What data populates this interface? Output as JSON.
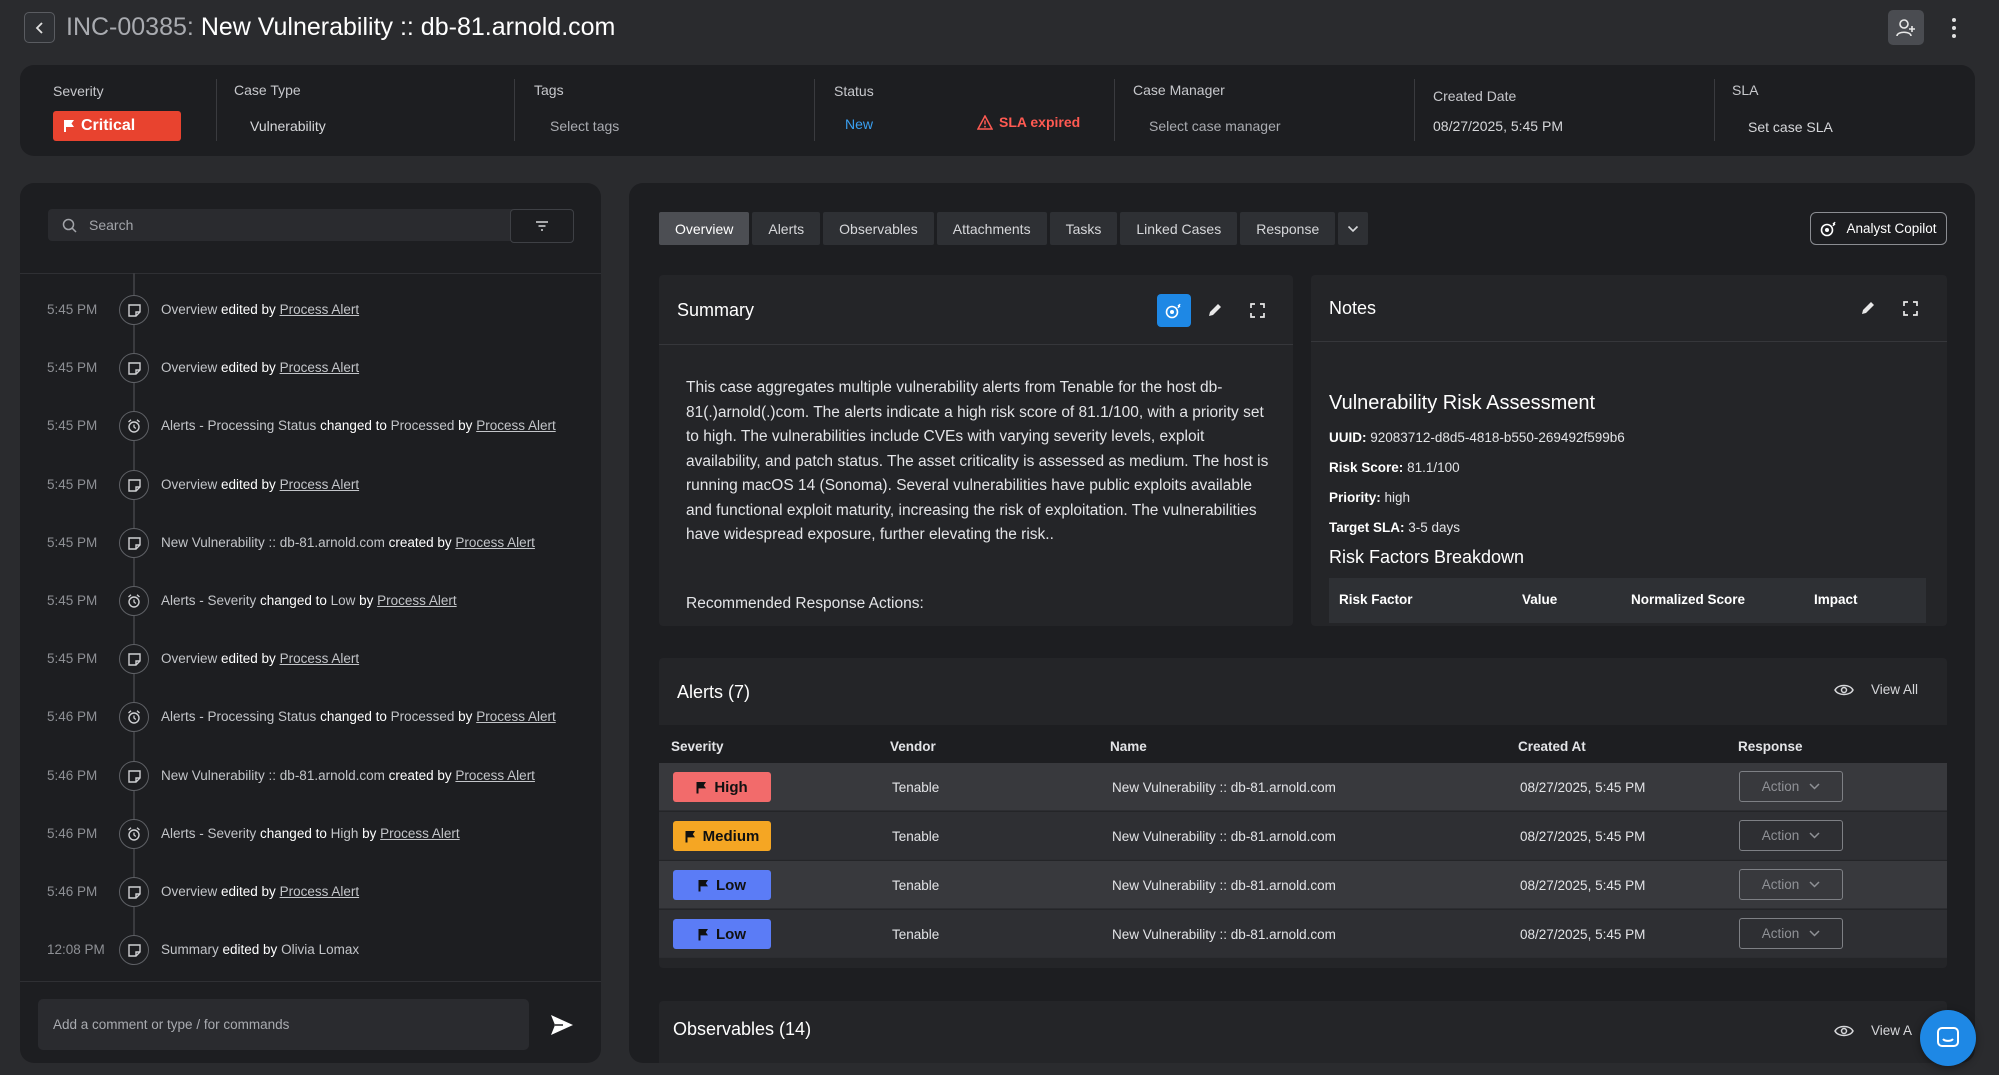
{
  "header": {
    "incident_id": "INC-00385:",
    "title": "New Vulnerability :: db-81.arnold.com"
  },
  "info": {
    "severity": {
      "label": "Severity",
      "value": "Critical",
      "color": "#e8432f"
    },
    "case_type": {
      "label": "Case Type",
      "value": "Vulnerability"
    },
    "tags": {
      "label": "Tags",
      "placeholder": "Select tags"
    },
    "status": {
      "label": "Status",
      "value": "New",
      "sla": "SLA expired"
    },
    "case_manager": {
      "label": "Case Manager",
      "placeholder": "Select case manager"
    },
    "created_date": {
      "label": "Created Date",
      "value": "08/27/2025, 5:45 PM"
    },
    "sla": {
      "label": "SLA",
      "placeholder": "Set case SLA"
    }
  },
  "left": {
    "search_placeholder": "Search",
    "comment_placeholder": "Add a comment or type / for commands",
    "timeline": [
      {
        "time": "5:45 PM",
        "icon": "note-icon",
        "a": "Overview",
        "verb": " edited by ",
        "b": "",
        "c": "",
        "actor": "Process Alert",
        "actor_link": true
      },
      {
        "time": "5:45 PM",
        "icon": "note-icon",
        "a": "Overview",
        "verb": " edited by ",
        "b": "",
        "c": "",
        "actor": "Process Alert",
        "actor_link": true
      },
      {
        "time": "5:45 PM",
        "icon": "alarm-icon",
        "a": "Alerts - Processing Status",
        "verb": " changed to ",
        "b": "Processed",
        "c": " by ",
        "actor": "Process Alert",
        "actor_link": true
      },
      {
        "time": "5:45 PM",
        "icon": "note-icon",
        "a": "Overview",
        "verb": " edited by ",
        "b": "",
        "c": "",
        "actor": "Process Alert",
        "actor_link": true
      },
      {
        "time": "5:45 PM",
        "icon": "note-icon",
        "a": "New Vulnerability :: db-81.arnold.com",
        "verb": " created by ",
        "b": "",
        "c": "",
        "actor": "Process Alert",
        "actor_link": true
      },
      {
        "time": "5:45 PM",
        "icon": "alarm-icon",
        "a": "Alerts - Severity",
        "verb": " changed to ",
        "b": "Low",
        "c": " by ",
        "actor": "Process Alert",
        "actor_link": true
      },
      {
        "time": "5:45 PM",
        "icon": "note-icon",
        "a": "Overview",
        "verb": " edited by ",
        "b": "",
        "c": "",
        "actor": "Process Alert",
        "actor_link": true
      },
      {
        "time": "5:46 PM",
        "icon": "alarm-icon",
        "a": "Alerts - Processing Status",
        "verb": " changed to ",
        "b": "Processed",
        "c": " by ",
        "actor": "Process Alert",
        "actor_link": true
      },
      {
        "time": "5:46 PM",
        "icon": "note-icon",
        "a": "New Vulnerability :: db-81.arnold.com",
        "verb": " created by ",
        "b": "",
        "c": "",
        "actor": "Process Alert",
        "actor_link": true
      },
      {
        "time": "5:46 PM",
        "icon": "alarm-icon",
        "a": "Alerts - Severity",
        "verb": " changed to ",
        "b": "High",
        "c": " by ",
        "actor": "Process Alert",
        "actor_link": true
      },
      {
        "time": "5:46 PM",
        "icon": "note-icon",
        "a": "Overview",
        "verb": " edited by ",
        "b": "",
        "c": "",
        "actor": "Process Alert",
        "actor_link": true
      },
      {
        "time": "12:08 PM",
        "icon": "note-icon",
        "a": "Summary",
        "verb": " edited by ",
        "b": "",
        "c": "",
        "actor": "Olivia Lomax",
        "actor_link": false
      }
    ]
  },
  "tabs": [
    "Overview",
    "Alerts",
    "Observables",
    "Attachments",
    "Tasks",
    "Linked Cases",
    "Response"
  ],
  "copilot_label": "Analyst Copilot",
  "summary": {
    "title": "Summary",
    "body": "This case aggregates multiple vulnerability alerts from Tenable for the host db-81(.)arnold(.)com. The alerts indicate a high risk score of 81.1/100, with a priority set to high. The vulnerabilities include CVEs with varying severity levels, exploit availability, and patch status. The asset criticality is assessed as medium. The host is running macOS 14 (Sonoma). Several vulnerabilities have public exploits available and functional exploit maturity, increasing the risk of exploitation. The vulnerabilities have widespread exposure, further elevating the risk..",
    "rec": "Recommended Response Actions:"
  },
  "notes": {
    "title": "Notes",
    "heading": "Vulnerability Risk Assessment",
    "uuid_label": "UUID:",
    "uuid": "92083712-d8d5-4818-b550-269492f599b6",
    "risk_label": "Risk Score:",
    "risk": "81.1/100",
    "priority_label": "Priority:",
    "priority": "high",
    "sla_label": "Target SLA:",
    "sla": "3-5 days",
    "breakdown": "Risk Factors Breakdown",
    "columns": [
      "Risk Factor",
      "Value",
      "Normalized Score",
      "Impact"
    ]
  },
  "alerts": {
    "title": "Alerts (7)",
    "view_all": "View All",
    "columns": [
      "Severity",
      "Vendor",
      "Name",
      "Created At",
      "Response"
    ],
    "rows": [
      {
        "severity": "High",
        "color": "#f26b6b",
        "vendor": "Tenable",
        "name": "New Vulnerability :: db-81.arnold.com",
        "created": "08/27/2025, 5:45 PM",
        "action": "Action"
      },
      {
        "severity": "Medium",
        "color": "#f5a623",
        "vendor": "Tenable",
        "name": "New Vulnerability :: db-81.arnold.com",
        "created": "08/27/2025, 5:45 PM",
        "action": "Action"
      },
      {
        "severity": "Low",
        "color": "#5b7cf6",
        "vendor": "Tenable",
        "name": "New Vulnerability :: db-81.arnold.com",
        "created": "08/27/2025, 5:45 PM",
        "action": "Action"
      },
      {
        "severity": "Low",
        "color": "#5b7cf6",
        "vendor": "Tenable",
        "name": "New Vulnerability :: db-81.arnold.com",
        "created": "08/27/2025, 5:45 PM",
        "action": "Action"
      }
    ]
  },
  "observables": {
    "title": "Observables (14)",
    "view_all": "View A"
  }
}
